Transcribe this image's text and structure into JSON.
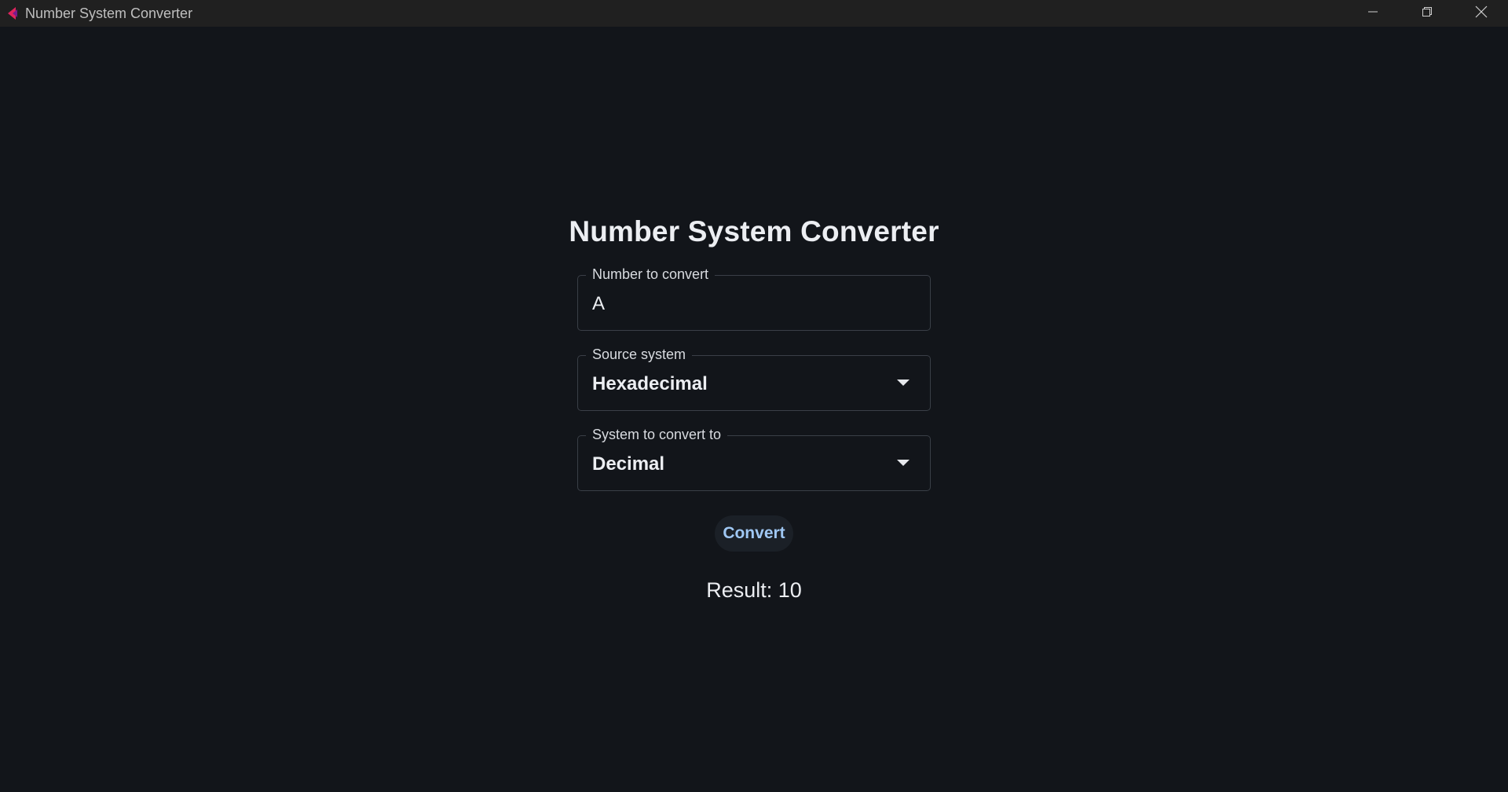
{
  "window": {
    "title": "Number System Converter",
    "controls": [
      "minimize-icon",
      "restore-icon",
      "close-icon"
    ]
  },
  "main": {
    "heading": "Number System Converter",
    "number_field": {
      "label": "Number to convert",
      "value": "A"
    },
    "source_select": {
      "label": "Source system",
      "value": "Hexadecimal"
    },
    "target_select": {
      "label": "System to convert to",
      "value": "Decimal"
    },
    "convert_button": "Convert",
    "result_text": "Result: 10"
  },
  "colors": {
    "background": "#12151a",
    "titlebar": "#202020",
    "button_text": "#9fc7f3",
    "app_icon": "#e0245e"
  }
}
